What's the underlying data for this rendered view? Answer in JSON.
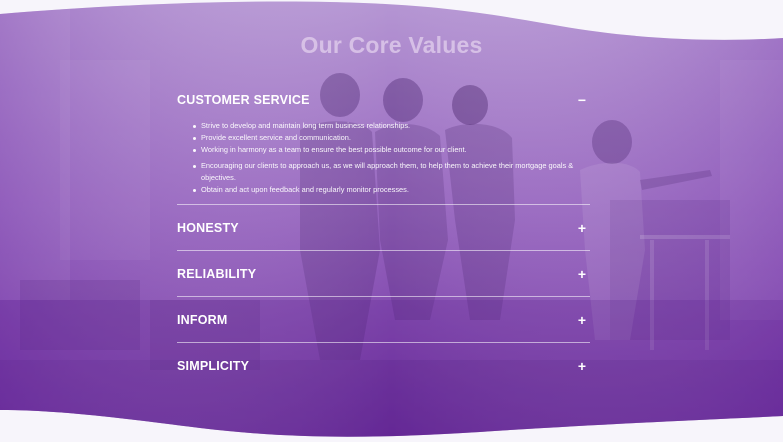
{
  "section": {
    "title": "Our Core Values"
  },
  "colors": {
    "overlay_top": "#9a6fc0",
    "overlay_bottom": "#6a2a9c",
    "accent": "#7b3db0",
    "text": "#ffffff"
  },
  "accordion": {
    "items": [
      {
        "title": "CUSTOMER SERVICE",
        "state": "expanded",
        "toggle_icon": "minus-icon",
        "toggle_symbol": "−",
        "bullets": [
          "Strive to develop and maintain long term business relationships.",
          "Provide excellent service and communication.",
          "Working in harmony as a team to ensure the best possible outcome for our client.",
          "Encouraging our clients to approach us, as we will approach them, to help them to achieve their mortgage goals & objectives.",
          "Obtain and act upon feedback and regularly monitor processes."
        ]
      },
      {
        "title": "HONESTY",
        "state": "collapsed",
        "toggle_icon": "plus-icon",
        "toggle_symbol": "+"
      },
      {
        "title": "RELIABILITY",
        "state": "collapsed",
        "toggle_icon": "plus-icon",
        "toggle_symbol": "+"
      },
      {
        "title": "INFORM",
        "state": "collapsed",
        "toggle_icon": "plus-icon",
        "toggle_symbol": "+"
      },
      {
        "title": "SIMPLICITY",
        "state": "collapsed",
        "toggle_icon": "plus-icon",
        "toggle_symbol": "+"
      }
    ]
  }
}
